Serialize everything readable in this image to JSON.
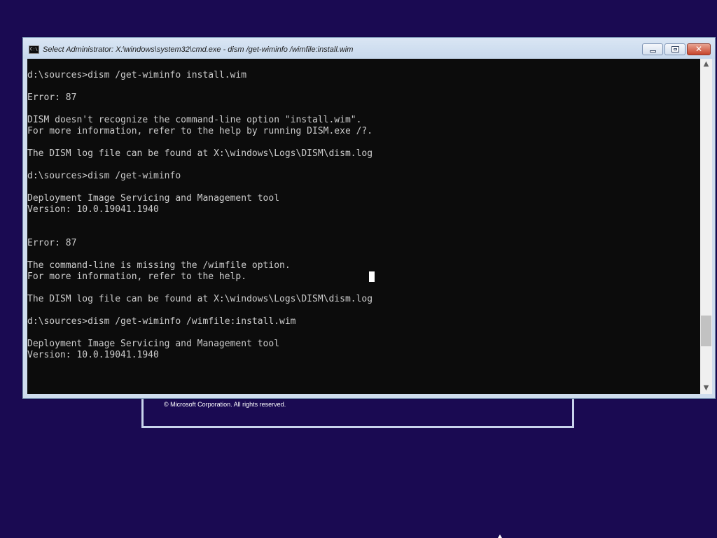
{
  "colors": {
    "desktop_background": "#1a0a52",
    "console_background": "#0c0c0c",
    "console_text": "#cccccc",
    "window_frame": "#cfddee",
    "close_button": "#c7452c"
  },
  "setup_window": {
    "copyright": "© Microsoft Corporation. All rights reserved."
  },
  "console_window": {
    "title": "Select Administrator: X:\\windows\\system32\\cmd.exe - dism  /get-wiminfo /wimfile:install.wim",
    "app_icon_text": "C:\\",
    "caption_buttons": {
      "minimize": "minimize-icon",
      "maximize": "restore-icon",
      "close": "close-icon"
    },
    "lines": [
      "d:\\sources>dism /get-wiminfo install.wim",
      "",
      "Error: 87",
      "",
      "DISM doesn't recognize the command-line option \"install.wim\".",
      "For more information, refer to the help by running DISM.exe /?.",
      "",
      "The DISM log file can be found at X:\\windows\\Logs\\DISM\\dism.log",
      "",
      "d:\\sources>dism /get-wiminfo",
      "",
      "Deployment Image Servicing and Management tool",
      "Version: 10.0.19041.1940",
      "",
      "",
      "Error: 87",
      "",
      "The command-line is missing the /wimfile option.",
      "For more information, refer to the help.",
      "",
      "The DISM log file can be found at X:\\windows\\Logs\\DISM\\dism.log",
      "",
      "d:\\sources>dism /get-wiminfo /wimfile:install.wim",
      "",
      "Deployment Image Servicing and Management tool",
      "Version: 10.0.19041.1940"
    ]
  },
  "scrollbar": {
    "up_arrow": "▲",
    "down_arrow": "▼",
    "position_fraction": 0.82
  }
}
